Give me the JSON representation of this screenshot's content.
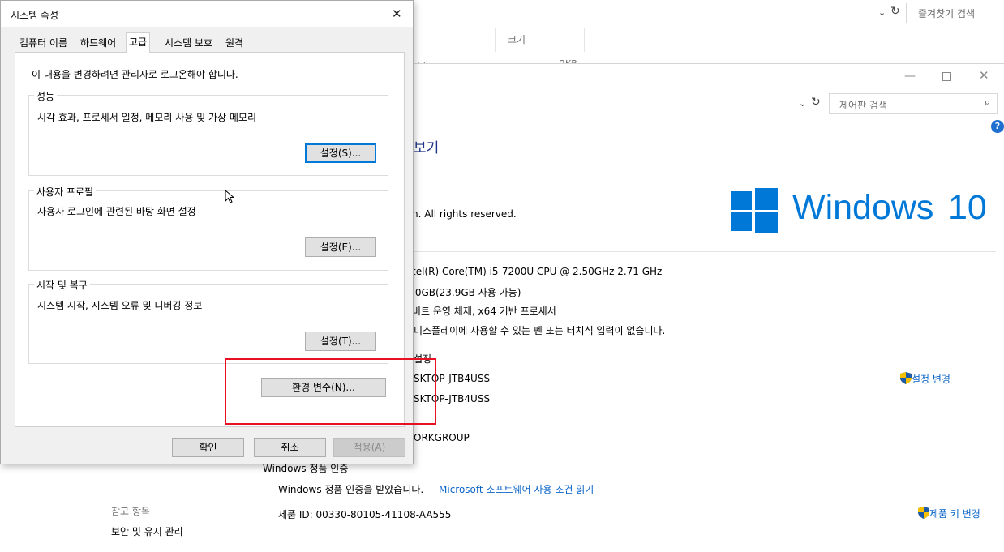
{
  "background_window": {
    "top_search_placeholder": "즐겨찾기 검색",
    "size_column_header": "크기",
    "partial_row_name": "고기",
    "partial_row_size": "2KB"
  },
  "control_panel": {
    "search_placeholder": "제어판 검색",
    "heading_partial": "보기",
    "copyright_partial": "n. All rights reserved.",
    "windows_logo_text": "Windows",
    "windows_logo_version": "10",
    "processor_partial": "tel(R) Core(TM) i5-7200U CPU @ 2.50GHz   2.71 GHz",
    "memory_partial": ".0GB(23.9GB 사용 가능)",
    "system_type_partial": "비트 운영 체제, x64 기반 프로세서",
    "pen_touch_partial": "디스플레이에 사용할 수 있는 펜 또는 터치식 입력이 없습니다.",
    "computer_section_partial": "설정",
    "computer_name_partial": "SKTOP-JTB4USS",
    "full_name_partial": "SKTOP-JTB4USS",
    "workgroup_partial": "ORKGROUP",
    "change_settings_label": "설정 변경",
    "activation_section": "Windows 정품 인증",
    "activation_status": "Windows 정품 인증을 받았습니다.",
    "license_link": "Microsoft 소프트웨어 사용 조건 읽기",
    "product_id": "제품 ID: 00330-80105-41108-AA555",
    "change_product_key": "제품 키 변경",
    "see_also": "참고 항목",
    "security_maintenance": "보안 및 유지 관리"
  },
  "dialog": {
    "title": "시스템 속성",
    "tabs": [
      "컴퓨터 이름",
      "하드웨어",
      "고급",
      "시스템 보호",
      "원격"
    ],
    "active_tab_index": 2,
    "admin_notice": "이 내용을 변경하려면 관리자로 로그온해야 합니다.",
    "performance": {
      "title": "성능",
      "description": "시각 효과, 프로세서 일정, 메모리 사용 및 가상 메모리",
      "button": "설정(S)..."
    },
    "user_profiles": {
      "title": "사용자 프로필",
      "description": "사용자 로그인에 관련된 바탕 화면 설정",
      "button": "설정(E)..."
    },
    "startup_recovery": {
      "title": "시작 및 복구",
      "description": "시스템 시작, 시스템 오류 및 디버깅 정보",
      "button": "설정(T)..."
    },
    "env_vars_button": "환경 변수(N)...",
    "ok_button": "확인",
    "cancel_button": "취소",
    "apply_button": "적용(A)"
  },
  "colors": {
    "accent": "#0078d7",
    "windows_blue": "#0078d7",
    "link": "#0a64c8",
    "highlight_box": "#e81123",
    "shield_blue": "#1e5aa8",
    "shield_yellow": "#f4c000"
  }
}
